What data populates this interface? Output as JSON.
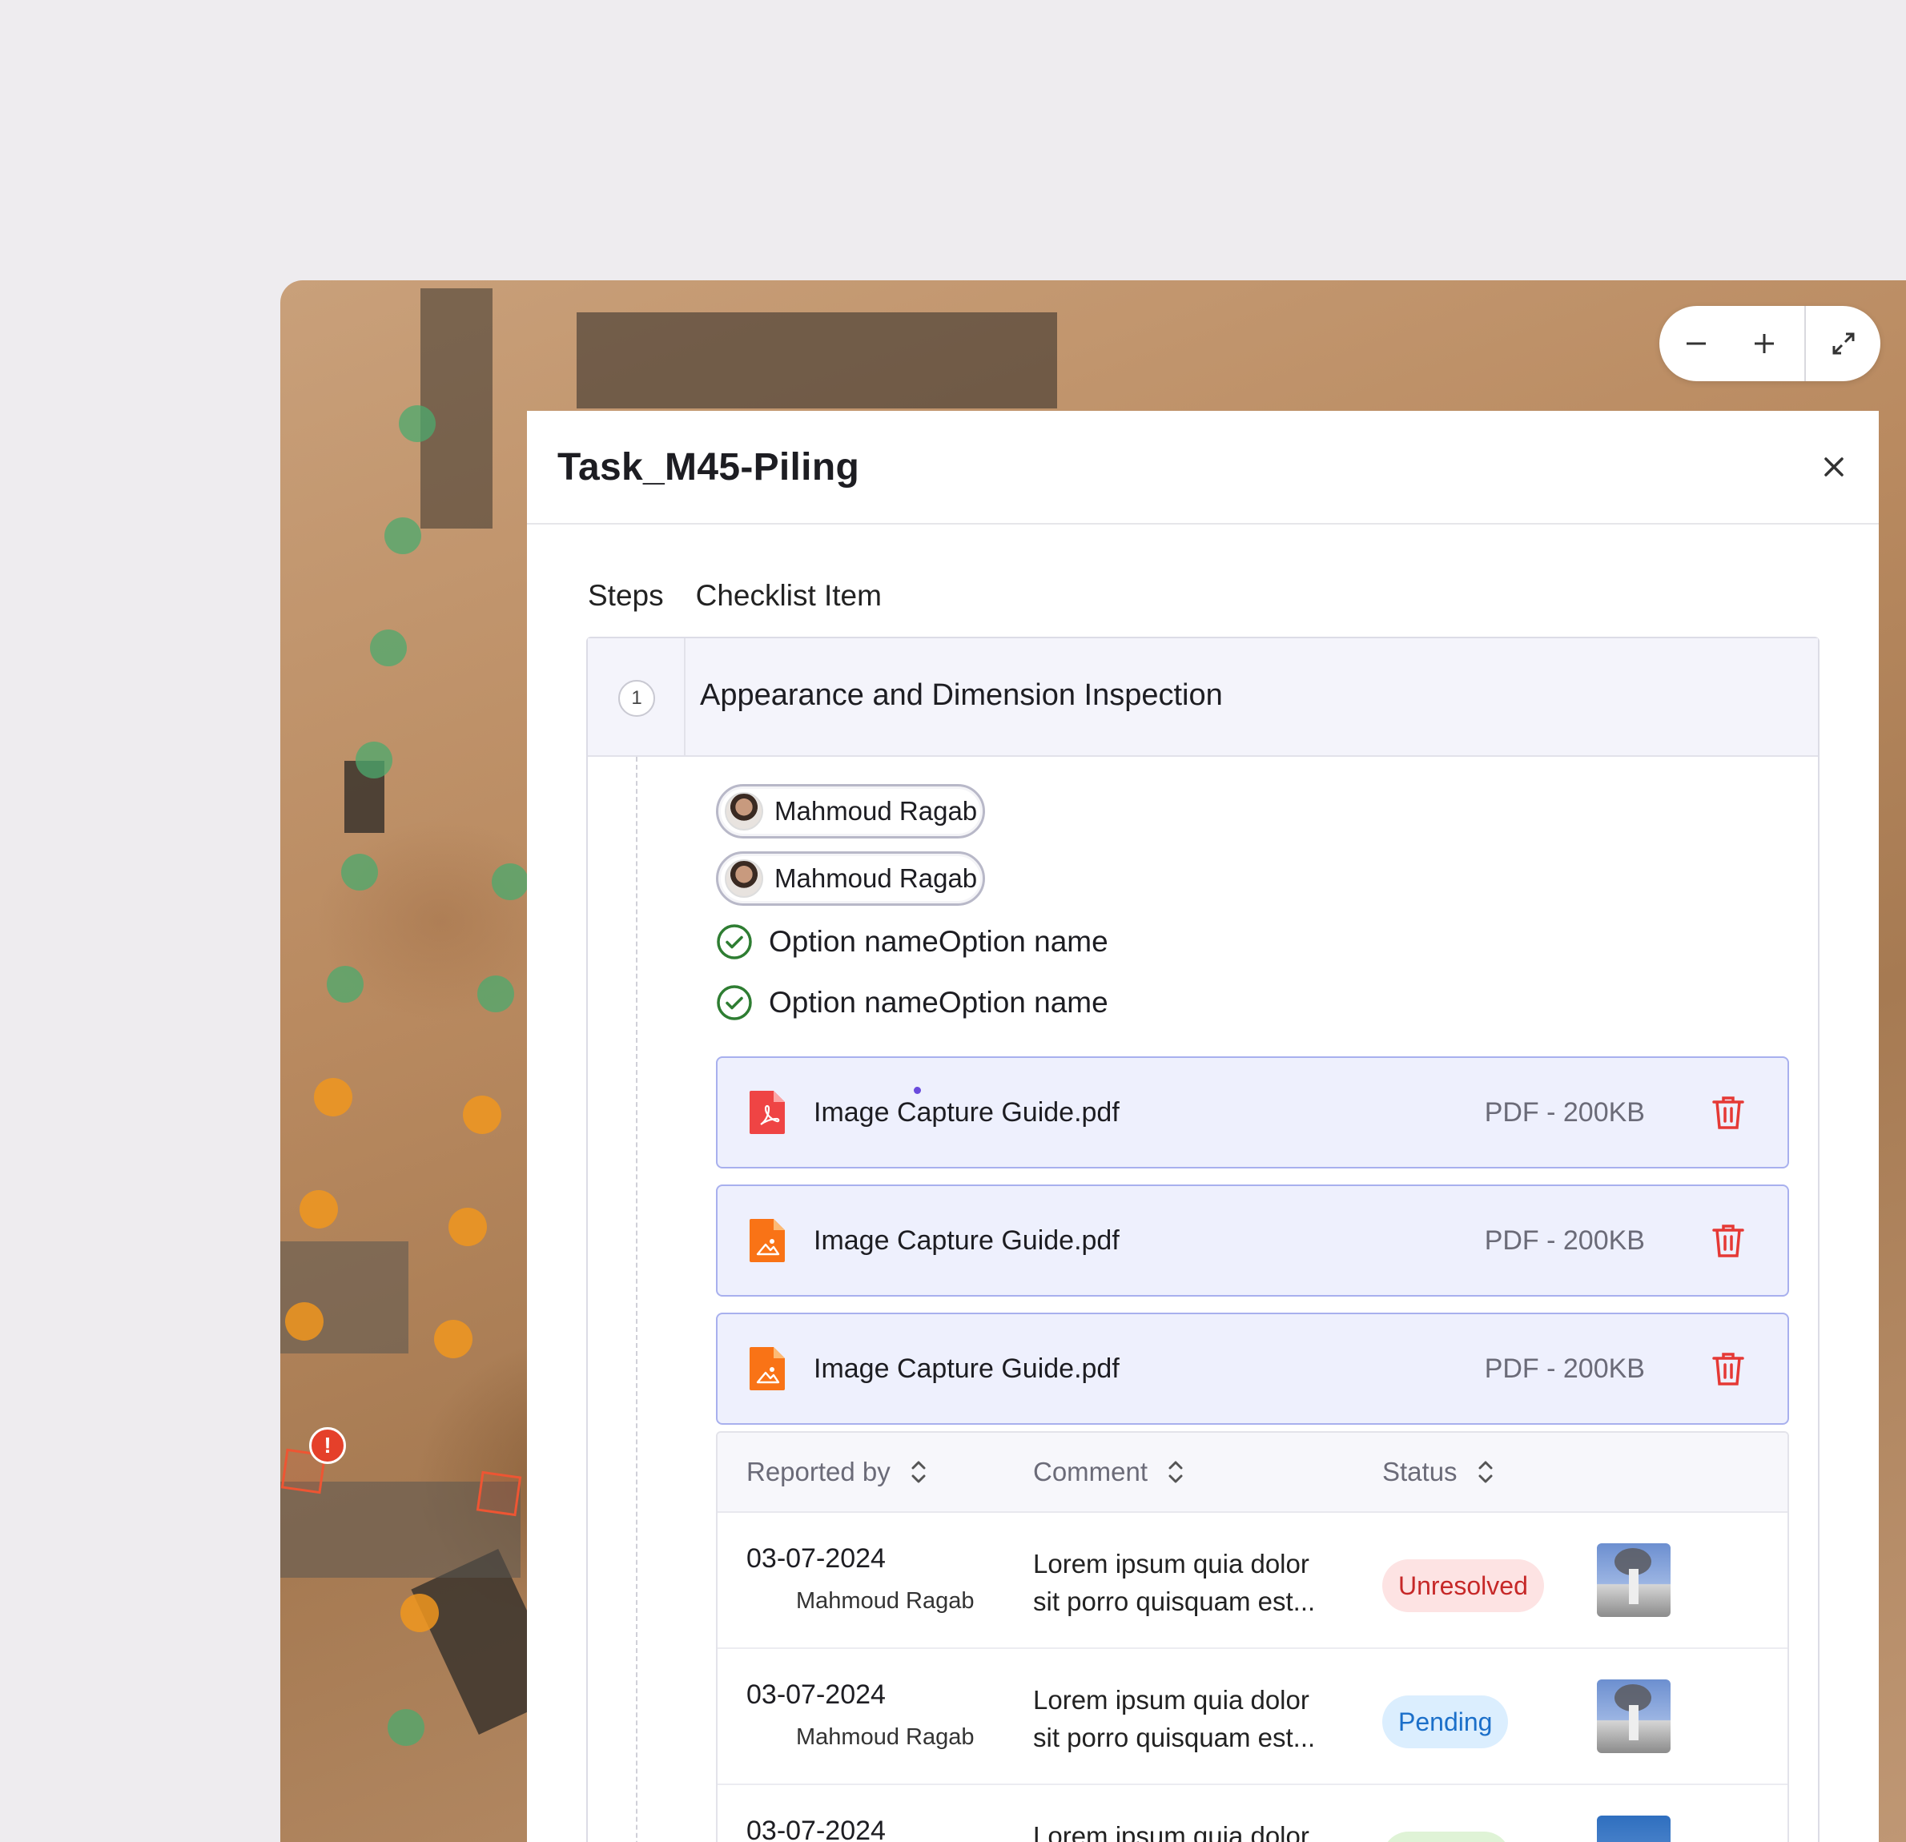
{
  "zoom_controls": {
    "zoom_out_icon": "minus-icon",
    "zoom_in_icon": "plus-icon",
    "fullscreen_icon": "expand-icon"
  },
  "panel": {
    "title": "Task_M45-Piling",
    "close_icon": "close-icon",
    "tabs": [
      {
        "label": "Steps"
      },
      {
        "label": "Checklist Item"
      }
    ],
    "step": {
      "number": "1",
      "title": "Appearance and Dimension Inspection",
      "assignees": [
        {
          "name": "Mahmoud Ragab"
        },
        {
          "name": "Mahmoud Ragab"
        }
      ],
      "options": [
        {
          "label": "Option nameOption name"
        },
        {
          "label": "Option nameOption name"
        }
      ],
      "files": [
        {
          "name": "Image Capture Guide.pdf",
          "meta": "PDF - 200KB",
          "icon": "pdf-icon",
          "color": "#ef4444"
        },
        {
          "name": "Image Capture Guide.pdf",
          "meta": "PDF - 200KB",
          "icon": "image-file-icon",
          "color": "#f97316"
        },
        {
          "name": "Image Capture Guide.pdf",
          "meta": "PDF - 200KB",
          "icon": "image-file-icon",
          "color": "#f97316"
        }
      ]
    },
    "table": {
      "columns": [
        {
          "label": "Reported by"
        },
        {
          "label": "Comment"
        },
        {
          "label": "Status"
        }
      ],
      "rows": [
        {
          "date": "03-07-2024",
          "reporter": "Mahmoud Ragab",
          "comment": "Lorem ipsum quia dolor sit porro quisquam est...",
          "status": "Unresolved"
        },
        {
          "date": "03-07-2024",
          "reporter": "Mahmoud Ragab",
          "comment": "Lorem ipsum quia dolor sit porro quisquam est...",
          "status": "Pending"
        },
        {
          "date": "03-07-2024",
          "reporter": "",
          "comment": "Lorem ipsum quia dolor",
          "status": ""
        }
      ]
    }
  },
  "colors": {
    "accent": "#a8b0ee",
    "danger": "#e53935",
    "success": "#2e7d32"
  }
}
